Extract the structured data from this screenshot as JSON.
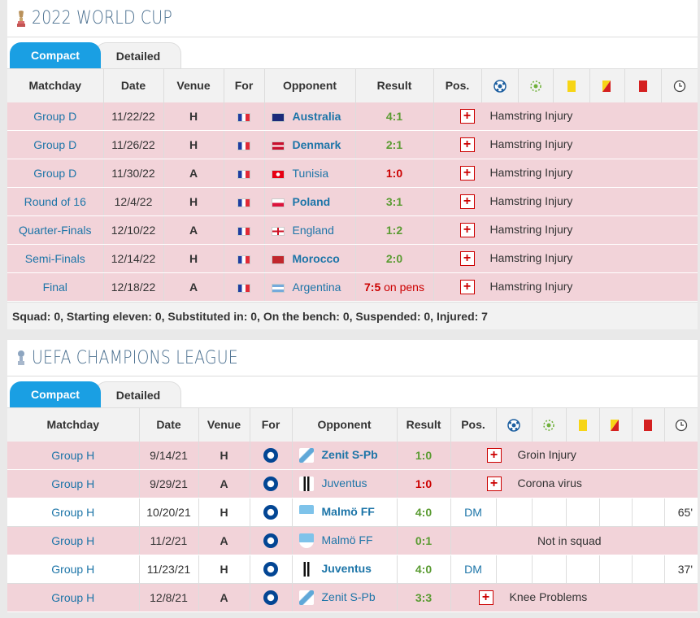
{
  "sections": [
    {
      "title": "2022 WORLD CUP",
      "tabs": {
        "compact": "Compact",
        "detailed": "Detailed"
      },
      "headers": {
        "matchday": "Matchday",
        "date": "Date",
        "venue": "Venue",
        "for": "For",
        "opponent": "Opponent",
        "result": "Result",
        "pos": "Pos."
      },
      "rows": [
        {
          "matchday": "Group D",
          "date": "11/22/22",
          "venue": "H",
          "opponent": "Australia",
          "result": "4:1",
          "note": "Hamstring Injury"
        },
        {
          "matchday": "Group D",
          "date": "11/26/22",
          "venue": "H",
          "opponent": "Denmark",
          "result": "2:1",
          "note": "Hamstring Injury"
        },
        {
          "matchday": "Group D",
          "date": "11/30/22",
          "venue": "A",
          "opponent": "Tunisia",
          "result": "1:0",
          "note": "Hamstring Injury"
        },
        {
          "matchday": "Round of 16",
          "date": "12/4/22",
          "venue": "H",
          "opponent": "Poland",
          "result": "3:1",
          "note": "Hamstring Injury"
        },
        {
          "matchday": "Quarter-Finals",
          "date": "12/10/22",
          "venue": "A",
          "opponent": "England",
          "result": "1:2",
          "note": "Hamstring Injury"
        },
        {
          "matchday": "Semi-Finals",
          "date": "12/14/22",
          "venue": "H",
          "opponent": "Morocco",
          "result": "2:0",
          "note": "Hamstring Injury"
        },
        {
          "matchday": "Final",
          "date": "12/18/22",
          "venue": "A",
          "opponent": "Argentina",
          "result": "7:5",
          "result_suffix": " on pens",
          "note": "Hamstring Injury"
        }
      ],
      "summary": "Squad: 0, Starting eleven: 0, Substituted in: 0, On the bench: 0, Suspended: 0, Injured: 7"
    },
    {
      "title": "UEFA CHAMPIONS LEAGUE",
      "tabs": {
        "compact": "Compact",
        "detailed": "Detailed"
      },
      "headers": {
        "matchday": "Matchday",
        "date": "Date",
        "venue": "Venue",
        "for": "For",
        "opponent": "Opponent",
        "result": "Result",
        "pos": "Pos."
      },
      "rows": [
        {
          "matchday": "Group H",
          "date": "9/14/21",
          "venue": "H",
          "opponent": "Zenit S-Pb",
          "result": "1:0",
          "note": "Groin Injury"
        },
        {
          "matchday": "Group H",
          "date": "9/29/21",
          "venue": "A",
          "opponent": "Juventus",
          "result": "1:0",
          "note": "Corona virus"
        },
        {
          "matchday": "Group H",
          "date": "10/20/21",
          "venue": "H",
          "opponent": "Malmö FF",
          "result": "4:0",
          "pos": "DM",
          "minutes": "65'"
        },
        {
          "matchday": "Group H",
          "date": "11/2/21",
          "venue": "A",
          "opponent": "Malmö FF",
          "result": "0:1",
          "note": "Not in squad"
        },
        {
          "matchday": "Group H",
          "date": "11/23/21",
          "venue": "H",
          "opponent": "Juventus",
          "result": "4:0",
          "pos": "DM",
          "minutes": "37'"
        },
        {
          "matchday": "Group H",
          "date": "12/8/21",
          "venue": "A",
          "opponent": "Zenit S-Pb",
          "result": "3:3",
          "note": "Knee Problems"
        }
      ]
    }
  ]
}
